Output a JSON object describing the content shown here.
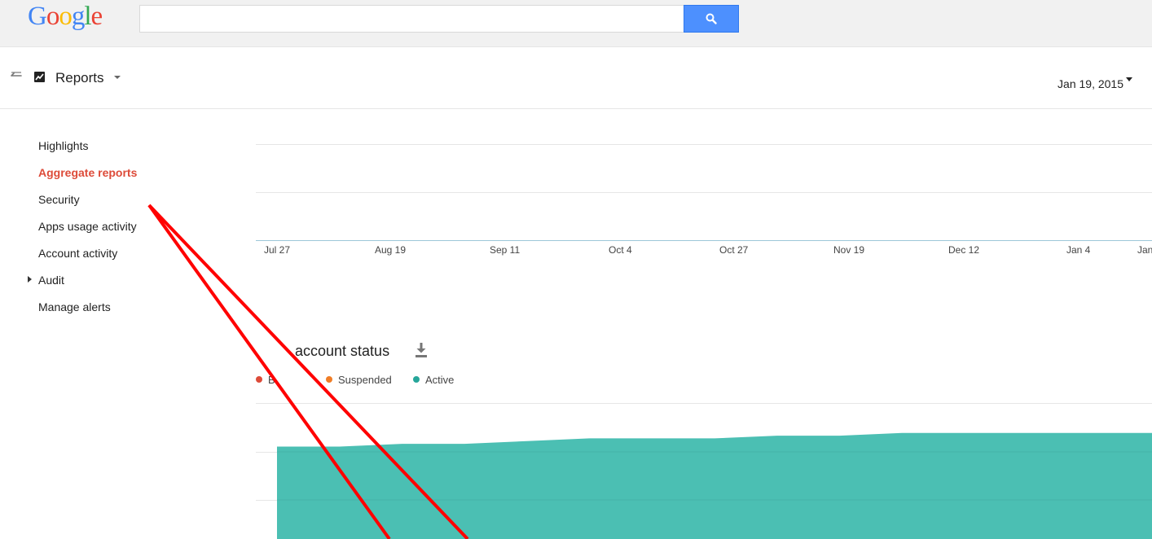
{
  "logo": {
    "letters": [
      "G",
      "o",
      "o",
      "g",
      "l",
      "e"
    ],
    "colors": [
      "#4285f4",
      "#ea4335",
      "#fbbc05",
      "#4285f4",
      "#34a853",
      "#ea4335"
    ]
  },
  "search": {
    "value": "",
    "placeholder": "",
    "button_icon": "search-icon"
  },
  "header": {
    "back_icon": "back-arrow-icon",
    "app_icon": "reports-chart-icon",
    "title": "Reports",
    "date": "Jan 19, 2015"
  },
  "sidebar": {
    "items": [
      {
        "label": "Highlights",
        "active": false
      },
      {
        "label": "Aggregate reports",
        "active": true
      },
      {
        "label": "Security",
        "active": false
      },
      {
        "label": "Apps usage activity",
        "active": false
      },
      {
        "label": "Account activity",
        "active": false
      },
      {
        "label": "Audit",
        "active": false,
        "expandable": true
      },
      {
        "label": "Manage alerts",
        "active": false
      }
    ]
  },
  "top_chart": {
    "x_ticks": [
      "Jul 27",
      "Aug 19",
      "Sep 11",
      "Oct 4",
      "Oct 27",
      "Nov 19",
      "Dec 12",
      "Jan 4",
      "Jan"
    ]
  },
  "account_chart": {
    "title": "account status",
    "download_icon": "download-icon",
    "legend": [
      {
        "label": "B",
        "color": "#dd4b39"
      },
      {
        "label": "Suspended",
        "color": "#f07d26"
      },
      {
        "label": "Active",
        "color": "#26a69a"
      }
    ]
  },
  "colors": {
    "accent_red": "#dd4b39",
    "search_blue": "#4d90fe",
    "area_fill": "#4bbfb3",
    "annotation_red": "#ff0000"
  },
  "chart_data": {
    "type": "area",
    "series": [
      {
        "name": "Active",
        "values": [
          0.68,
          0.68,
          0.7,
          0.7,
          0.72,
          0.74,
          0.74,
          0.74,
          0.76,
          0.76,
          0.78,
          0.78,
          0.78,
          0.78,
          0.78
        ]
      }
    ],
    "legend": [
      "B",
      "Suspended",
      "Active"
    ],
    "grid": true
  }
}
